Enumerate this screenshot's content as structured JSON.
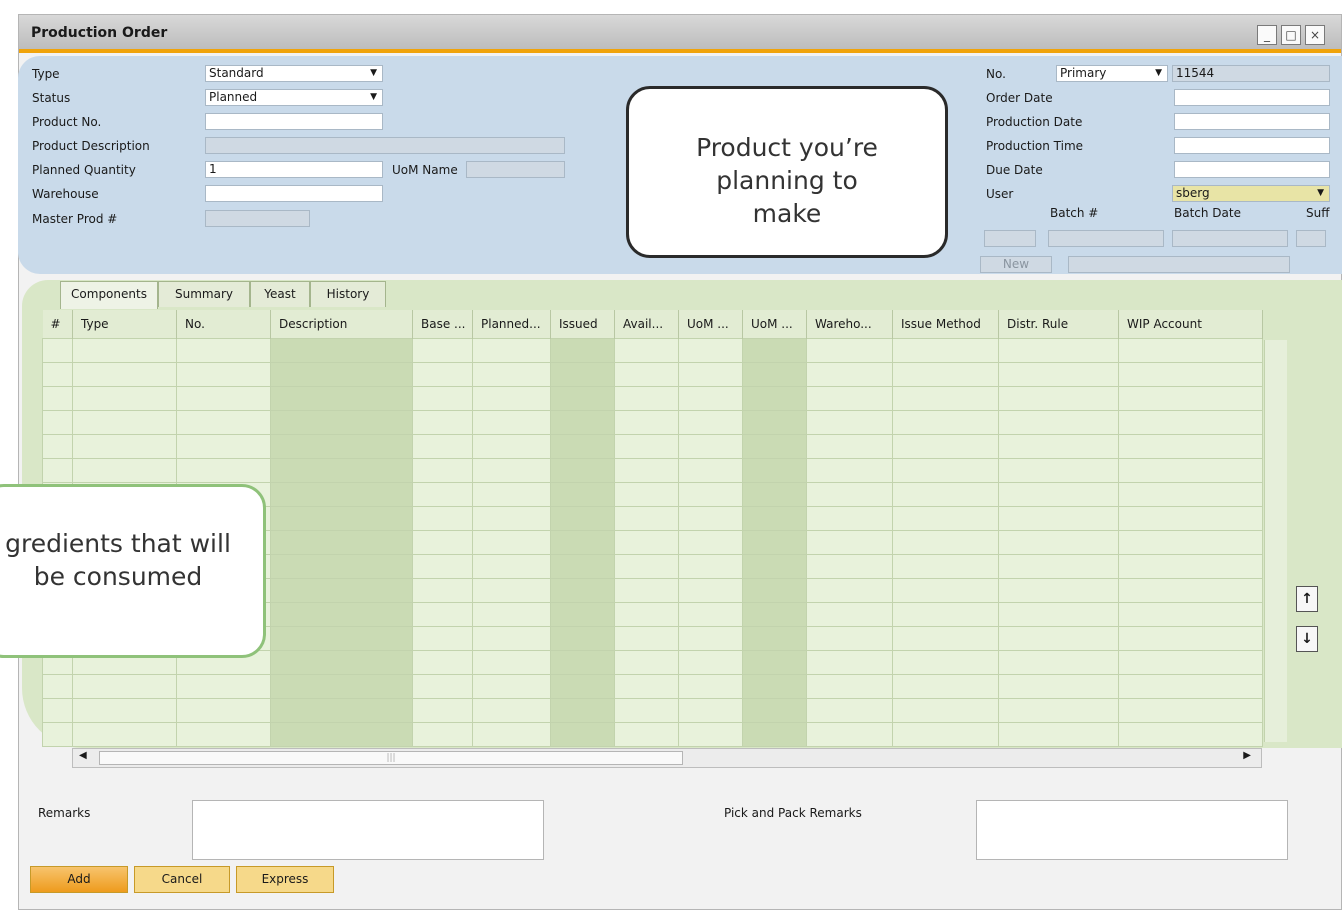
{
  "window": {
    "title": "Production Order",
    "controls": [
      "_",
      "□",
      "×"
    ]
  },
  "header_left": {
    "type_label": "Type",
    "type_value": "Standard",
    "status_label": "Status",
    "status_value": "Planned",
    "product_no_label": "Product No.",
    "product_no_value": "",
    "product_desc_label": "Product Description",
    "product_desc_value": "",
    "planned_qty_label": "Planned Quantity",
    "planned_qty_value": "1",
    "uom_name_label": "UoM Name",
    "uom_name_value": "",
    "warehouse_label": "Warehouse",
    "warehouse_value": "",
    "master_prod_label": "Master Prod #",
    "master_prod_value": ""
  },
  "header_right": {
    "no_label": "No.",
    "series_value": "Primary",
    "no_value": "11544",
    "order_date_label": "Order Date",
    "production_date_label": "Production Date",
    "production_time_label": "Production Time",
    "due_date_label": "Due Date",
    "user_label": "User",
    "user_value": "sberg",
    "batch_label": "Batch #",
    "batch_date_label": "Batch Date",
    "suff_label": "Suff",
    "new_label": "New"
  },
  "callouts": {
    "product": "Product you’re planning to make",
    "ingredients": "gredients that will be consumed"
  },
  "tabs": [
    "Components",
    "Summary",
    "Yeast",
    "History"
  ],
  "grid": {
    "columns": [
      "#",
      "Type",
      "No.",
      "Description",
      "Base ...",
      "Planned...",
      "Issued",
      "Avail...",
      "UoM ...",
      "UoM ...",
      "Wareho...",
      "Issue Method",
      "Distr. Rule",
      "WIP Account"
    ],
    "dark_columns": [
      3,
      6,
      9
    ],
    "row_count": 17
  },
  "footer": {
    "remarks_label": "Remarks",
    "pick_pack_label": "Pick and Pack Remarks",
    "add_label": "Add",
    "cancel_label": "Cancel",
    "express_label": "Express"
  },
  "colors": {
    "accent": "#f0a30a",
    "header_bg": "#c9daea",
    "grid_bg": "#d9e7c7",
    "user_field": "#e8e4a6"
  },
  "icons": {
    "up": "arrow-up-icon",
    "down": "arrow-down-icon"
  }
}
